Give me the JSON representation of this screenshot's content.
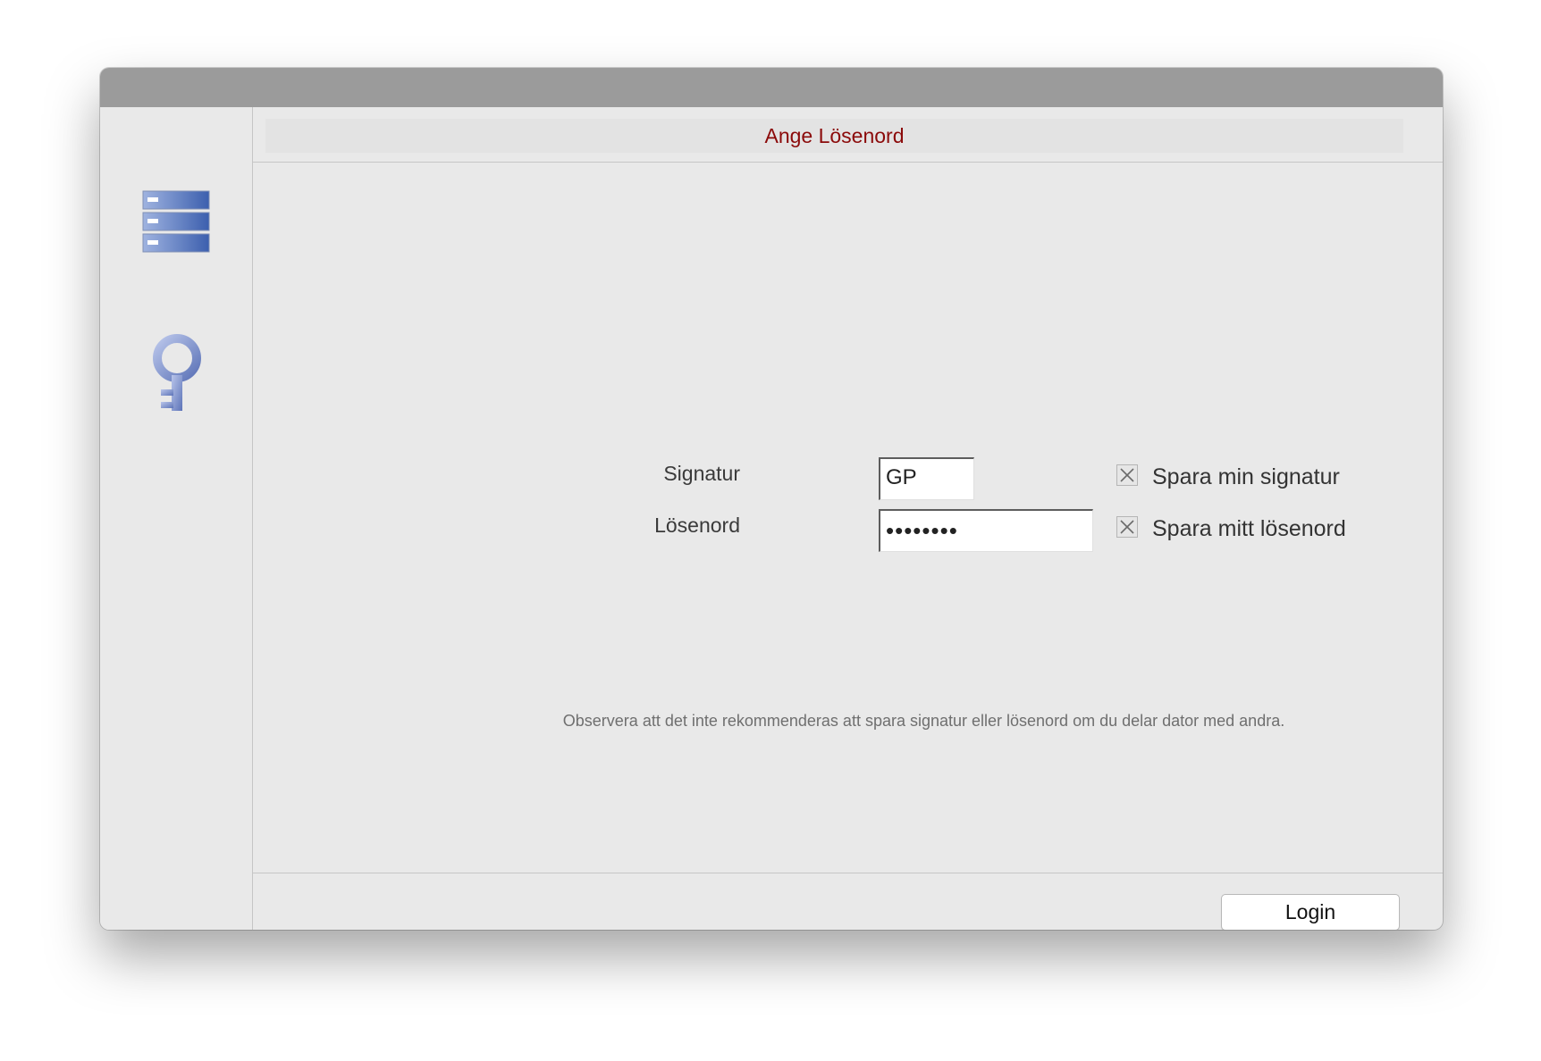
{
  "dialog": {
    "title": "Ange Lösenord"
  },
  "sidebar": {
    "icons": [
      "server-stack-icon",
      "key-icon"
    ]
  },
  "form": {
    "signature_label": "Signatur",
    "signature_value": "GP",
    "password_label": "Lösenord",
    "password_value": "••••••••",
    "save_signature_label": "Spara min signatur",
    "save_signature_checked": true,
    "save_password_label": "Spara mitt lösenord",
    "save_password_checked": true
  },
  "note": "Observera att det inte rekommenderas att spara signatur eller lösenord om du delar dator med andra.",
  "footer": {
    "login_label": "Login"
  },
  "colors": {
    "title_text": "#8b0a0a",
    "titlebar": "#9b9b9b",
    "window_bg": "#e9e9e9",
    "icon_blue": "#4f72b8"
  }
}
